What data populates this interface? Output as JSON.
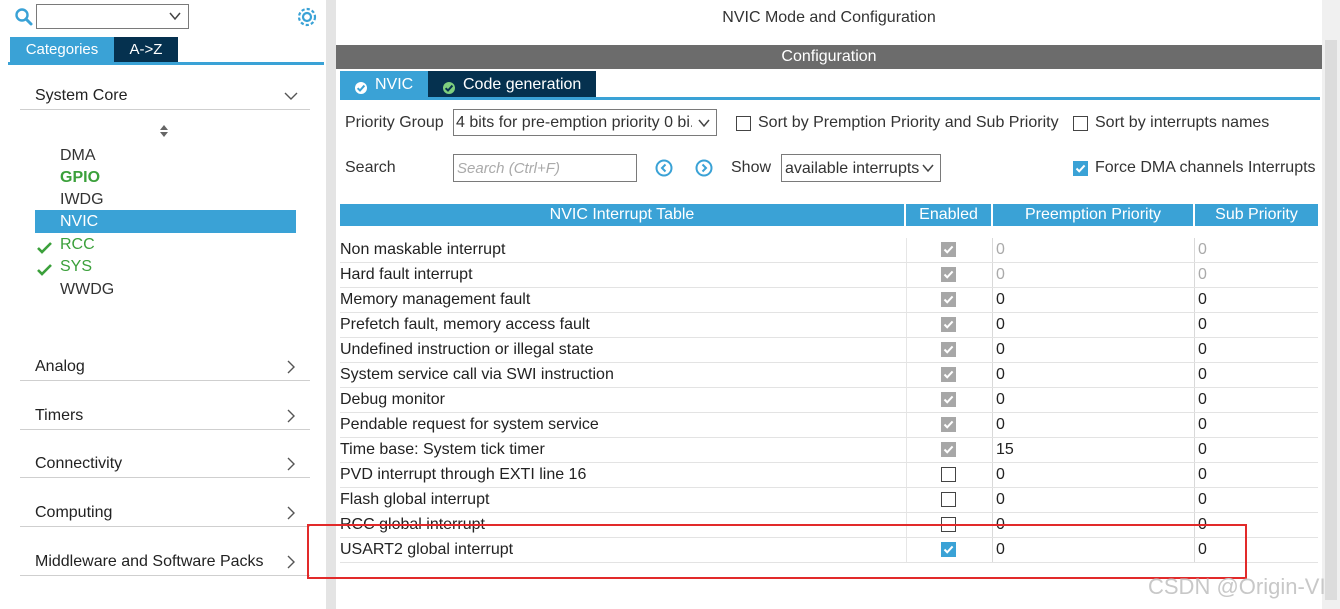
{
  "left_panel": {
    "search_combo_value": "",
    "tabs": {
      "categories": "Categories",
      "atoz": "A->Z"
    },
    "sections": {
      "system_core": "System Core",
      "analog": "Analog",
      "timers": "Timers",
      "connectivity": "Connectivity",
      "computing": "Computing",
      "middleware": "Middleware and Software Packs"
    },
    "system_core_items": [
      "DMA",
      "GPIO",
      "IWDG",
      "NVIC",
      "RCC",
      "SYS",
      "WWDG"
    ]
  },
  "header": {
    "mode_title": "NVIC Mode and Configuration",
    "configuration_label": "Configuration"
  },
  "config_tabs": {
    "nvic": "NVIC",
    "codegen": "Code generation"
  },
  "controls": {
    "priority_group_label": "Priority Group",
    "priority_group_value": "4 bits for pre-emption priority 0 bi..",
    "sort_by_priority_label": "Sort by Premption Priority and Sub Priority",
    "sort_by_priority_checked": false,
    "sort_by_name_label": "Sort by interrupts names",
    "sort_by_name_checked": false,
    "search_label": "Search",
    "search_placeholder": "Search (Ctrl+F)",
    "show_label": "Show",
    "show_value": "available interrupts",
    "force_dma_label": "Force DMA channels Interrupts",
    "force_dma_checked": true
  },
  "table": {
    "headers": {
      "name": "NVIC Interrupt Table",
      "enabled": "Enabled",
      "preemption": "Preemption Priority",
      "sub": "Sub Priority"
    },
    "rows": [
      {
        "name": "Non maskable interrupt",
        "enabled": "locked",
        "pre": "0",
        "sub": "0",
        "muted": true
      },
      {
        "name": "Hard fault interrupt",
        "enabled": "locked",
        "pre": "0",
        "sub": "0",
        "muted": true
      },
      {
        "name": "Memory management fault",
        "enabled": "locked",
        "pre": "0",
        "sub": "0",
        "muted": false
      },
      {
        "name": "Prefetch fault, memory access fault",
        "enabled": "locked",
        "pre": "0",
        "sub": "0",
        "muted": false
      },
      {
        "name": "Undefined instruction or illegal state",
        "enabled": "locked",
        "pre": "0",
        "sub": "0",
        "muted": false
      },
      {
        "name": "System service call via SWI instruction",
        "enabled": "locked",
        "pre": "0",
        "sub": "0",
        "muted": false
      },
      {
        "name": "Debug monitor",
        "enabled": "locked",
        "pre": "0",
        "sub": "0",
        "muted": false
      },
      {
        "name": "Pendable request for system service",
        "enabled": "locked",
        "pre": "0",
        "sub": "0",
        "muted": false
      },
      {
        "name": "Time base: System tick timer",
        "enabled": "locked",
        "pre": "15",
        "sub": "0",
        "muted": false
      },
      {
        "name": "PVD interrupt through EXTI line 16",
        "enabled": "off",
        "pre": "0",
        "sub": "0",
        "muted": false
      },
      {
        "name": "Flash global interrupt",
        "enabled": "off",
        "pre": "0",
        "sub": "0",
        "muted": false
      },
      {
        "name": "RCC global interrupt",
        "enabled": "off",
        "pre": "0",
        "sub": "0",
        "muted": false
      },
      {
        "name": "USART2 global interrupt",
        "enabled": "on",
        "pre": "0",
        "sub": "0",
        "muted": false
      }
    ]
  },
  "watermark": "CSDN @Origin-VI",
  "colors": {
    "accent": "#3aa2d6",
    "dark_tab": "#05314f",
    "config_bar": "#6c6c6c",
    "green": "#3ba03b",
    "highlight": "#e22a2a"
  }
}
